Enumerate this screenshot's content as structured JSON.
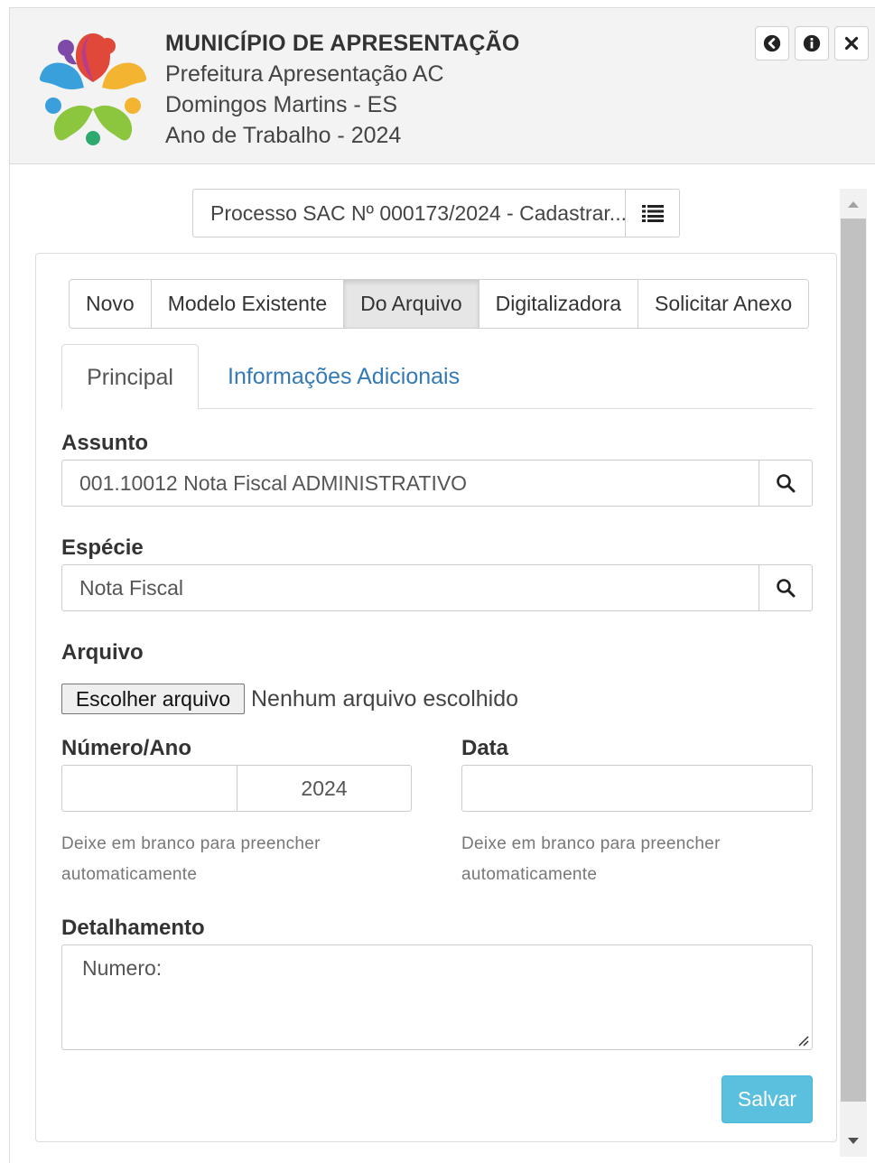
{
  "header": {
    "org_name": "MUNICÍPIO DE APRESENTAÇÃO",
    "org_unit": "Prefeitura Apresentação AC",
    "city": "Domingos Martins - ES",
    "work_year": "Ano de Trabalho - 2024",
    "buttons": [
      "back-icon",
      "info-icon",
      "close-icon"
    ]
  },
  "breadcrumb": {
    "text": "Processo SAC Nº 000173/2024 - Cadastrar...",
    "menu_icon": "list-icon"
  },
  "source_buttons": [
    {
      "label": "Novo",
      "active": false
    },
    {
      "label": "Modelo Existente",
      "active": false
    },
    {
      "label": "Do Arquivo",
      "active": true
    },
    {
      "label": "Digitalizadora",
      "active": false
    },
    {
      "label": "Solicitar Anexo",
      "active": false
    }
  ],
  "tabs": [
    {
      "label": "Principal",
      "active": true
    },
    {
      "label": "Informações Adicionais",
      "active": false
    }
  ],
  "form": {
    "assunto": {
      "label": "Assunto",
      "value": "001.10012 Nota Fiscal  ADMINISTRATIVO"
    },
    "especie": {
      "label": "Espécie",
      "value": "Nota Fiscal"
    },
    "arquivo": {
      "label": "Arquivo",
      "button": "Escolher arquivo",
      "status": "Nenhum arquivo escolhido"
    },
    "numero_ano": {
      "label": "Número/Ano",
      "numero": "",
      "ano": "2024",
      "help_line1": "Deixe em branco para preencher",
      "help_line2": "automaticamente"
    },
    "data": {
      "label": "Data",
      "value": "",
      "help_line1": "Deixe em branco para preencher",
      "help_line2": "automaticamente"
    },
    "detalhamento": {
      "label": "Detalhamento",
      "value": "Numero:"
    },
    "save_label": "Salvar"
  },
  "colors": {
    "link": "#337ab7",
    "save_button": "#5bc0de",
    "header_bg": "#f3f3f3"
  }
}
